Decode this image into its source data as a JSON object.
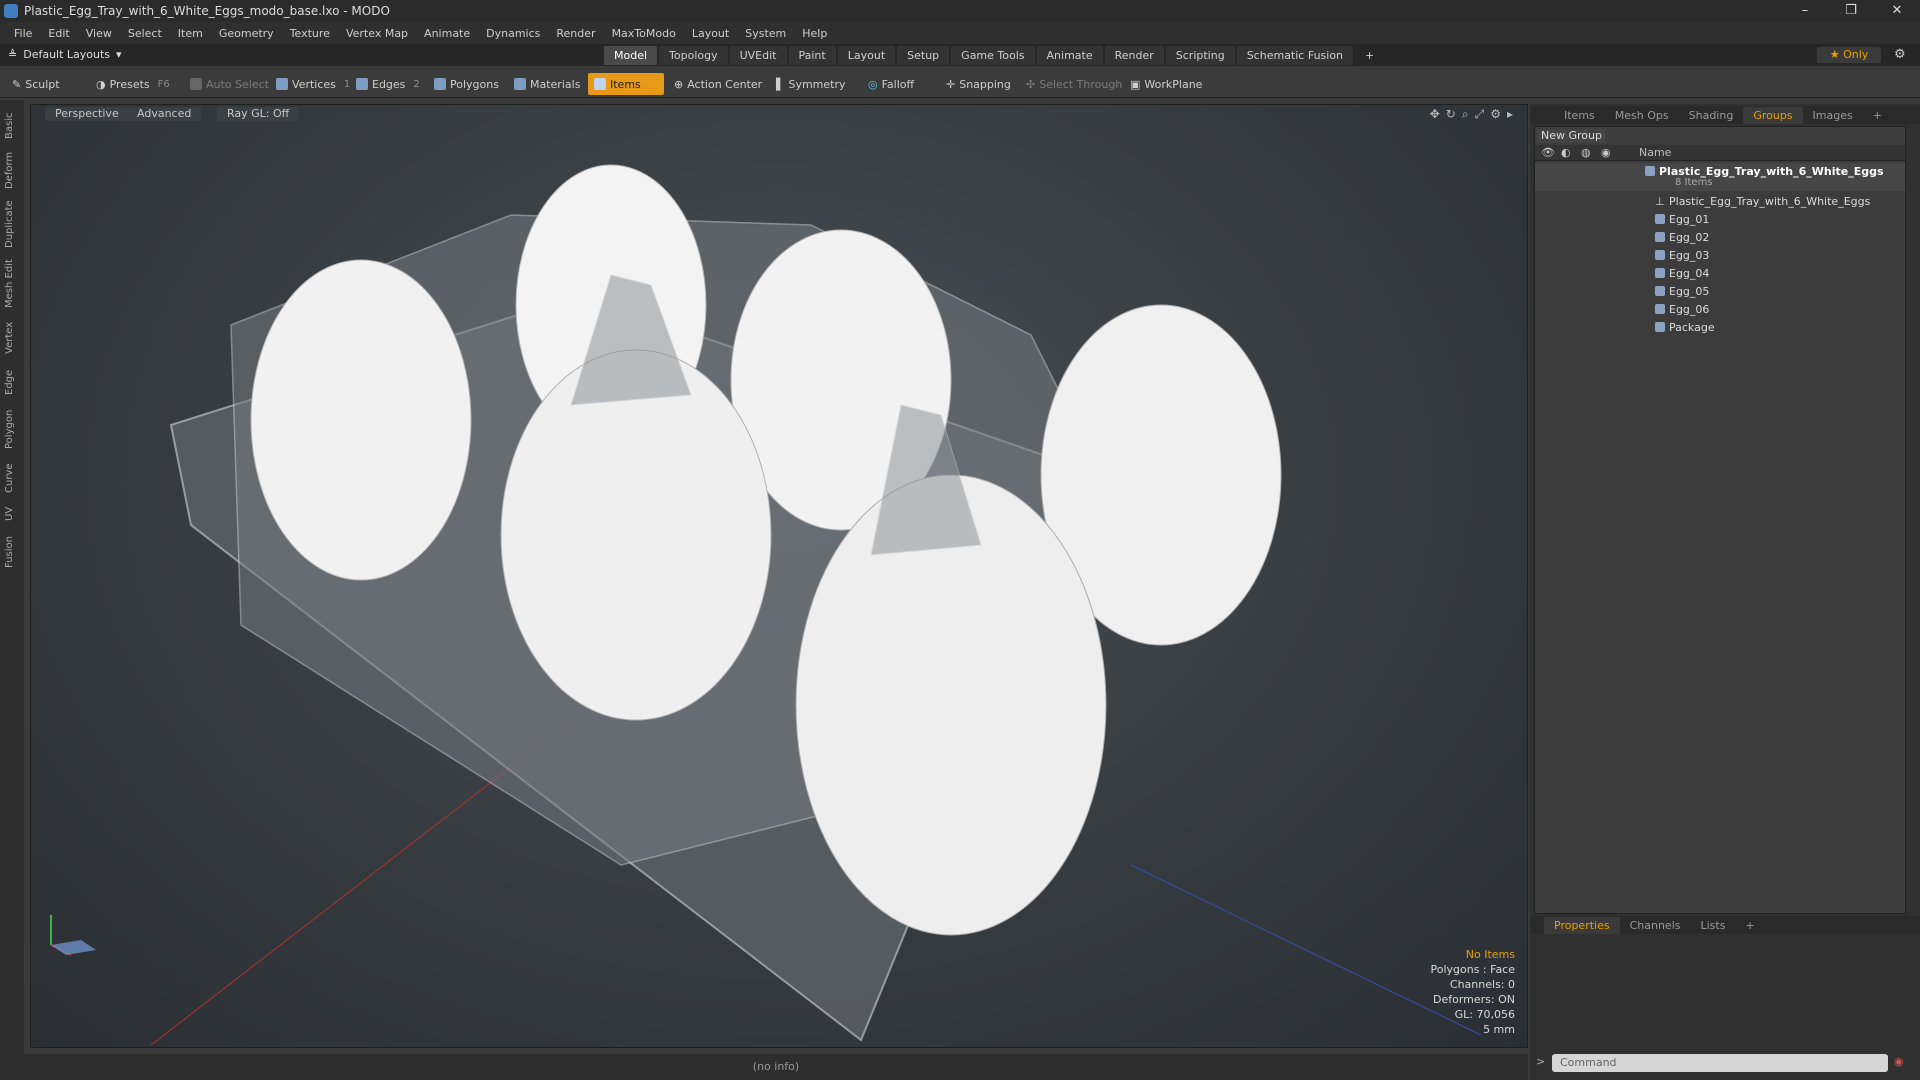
{
  "window": {
    "title": "Plastic_Egg_Tray_with_6_White_Eggs_modo_base.lxo - MODO"
  },
  "menu": [
    "File",
    "Edit",
    "View",
    "Select",
    "Item",
    "Geometry",
    "Texture",
    "Vertex Map",
    "Animate",
    "Dynamics",
    "Render",
    "MaxToModo",
    "Layout",
    "System",
    "Help"
  ],
  "layout": {
    "preset": "Default Layouts",
    "tabs": [
      "Model",
      "Topology",
      "UVEdit",
      "Paint",
      "Layout",
      "Setup",
      "Game Tools",
      "Animate",
      "Render",
      "Scripting",
      "Schematic Fusion"
    ],
    "active_tab": "Model",
    "only_label": "Only"
  },
  "toolbar": {
    "sculpt": "Sculpt",
    "presets": "Presets",
    "presets_key": "F6",
    "auto_select": "Auto Select",
    "vertices": "Vertices",
    "vertices_key": "1",
    "edges": "Edges",
    "edges_key": "2",
    "polygons": "Polygons",
    "materials": "Materials",
    "items": "Items",
    "action_center": "Action Center",
    "symmetry": "Symmetry",
    "falloff": "Falloff",
    "snapping": "Snapping",
    "select_through": "Select Through",
    "workplane": "WorkPlane"
  },
  "left_tabs": [
    "Basic",
    "Deform",
    "Duplicate",
    "Mesh Edit",
    "Vertex",
    "Edge",
    "Polygon",
    "Curve",
    "UV",
    "Fusion"
  ],
  "viewport": {
    "view": "Perspective",
    "shading": "Advanced",
    "raygl": "Ray GL: Off",
    "stats": {
      "selection": "No Items",
      "polygons": "Polygons : Face",
      "channels": "Channels: 0",
      "deformers": "Deformers: ON",
      "gl": "GL: 70,056",
      "unit": "5 mm"
    }
  },
  "right_panel": {
    "top_tabs": [
      "Items",
      "Mesh Ops",
      "Shading",
      "Groups",
      "Images"
    ],
    "active_top_tab": "Groups",
    "new_group": "New Group",
    "name_header": "Name",
    "root": {
      "label": "Plastic_Egg_Tray_with_6_White_Eggs",
      "count": "8 Items"
    },
    "children": [
      "Plastic_Egg_Tray_with_6_White_Eggs",
      "Egg_01",
      "Egg_02",
      "Egg_03",
      "Egg_04",
      "Egg_05",
      "Egg_06",
      "Package"
    ],
    "bottom_tabs": [
      "Properties",
      "Channels",
      "Lists"
    ],
    "active_bottom_tab": "Properties",
    "command_placeholder": "Command"
  },
  "status": {
    "info": "(no info)"
  }
}
